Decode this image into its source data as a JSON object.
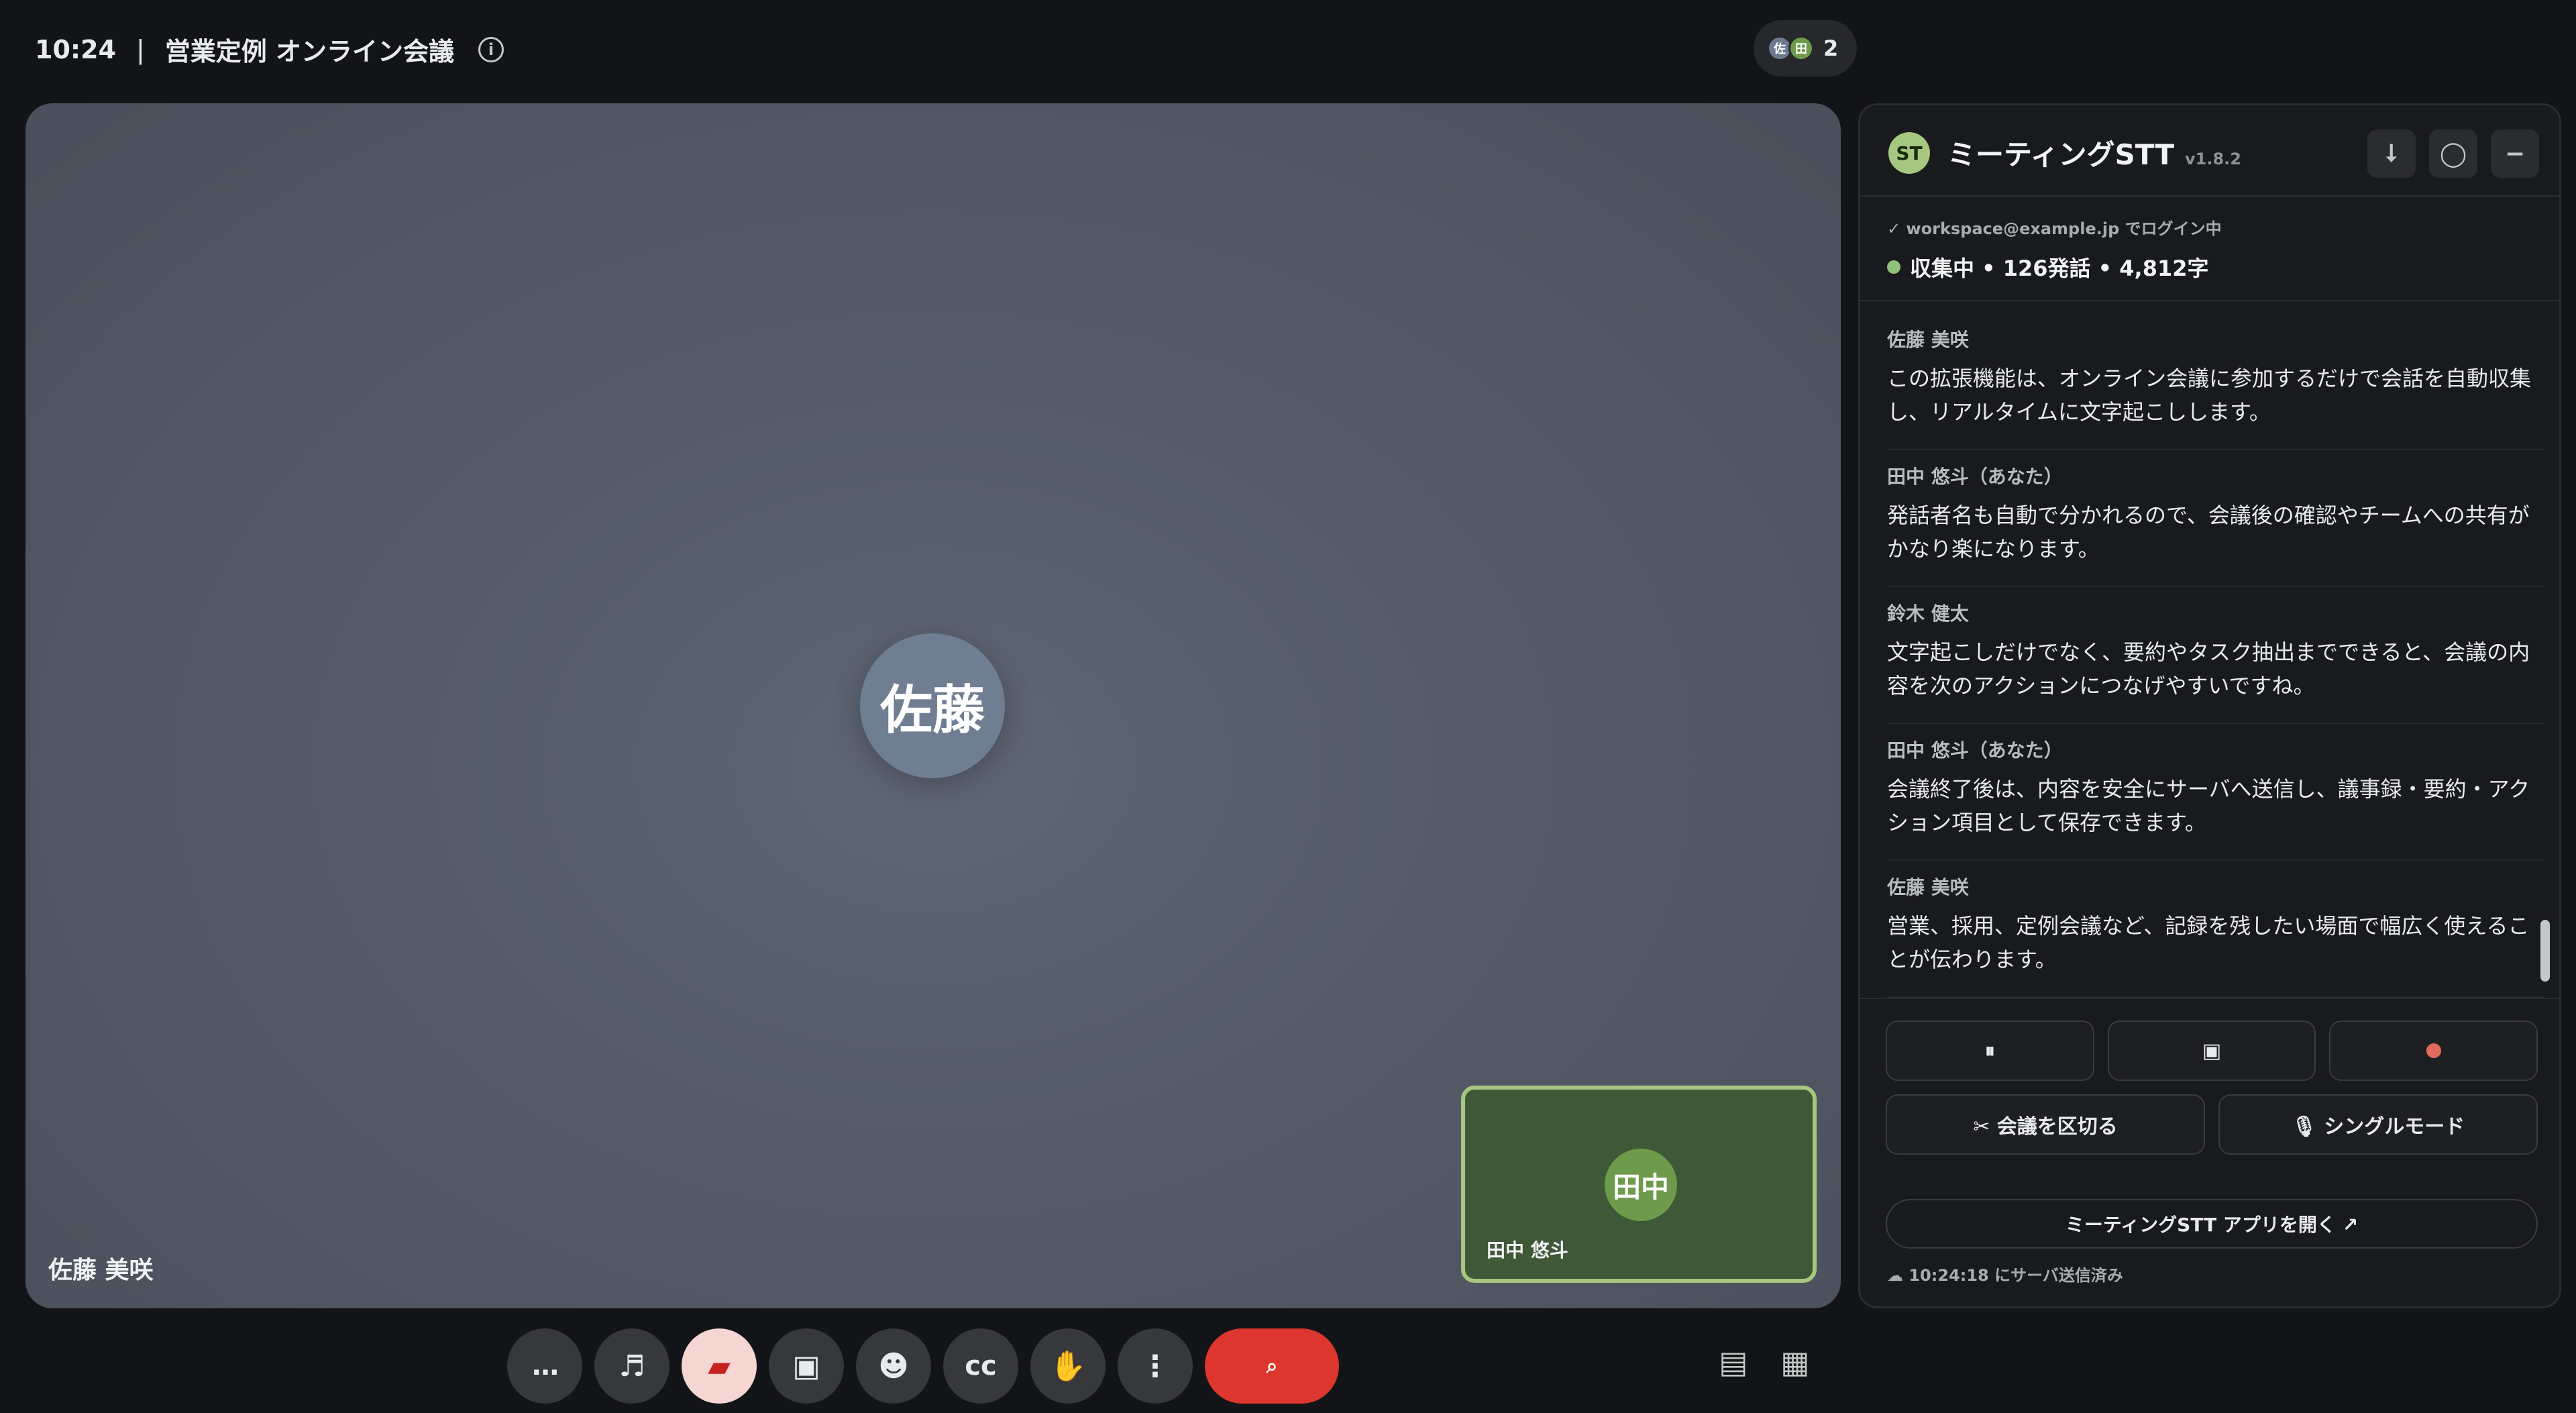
{
  "topbar": {
    "time": "10:24",
    "separator": "|",
    "meeting_title": "営業定例 オンライン会議",
    "info_icon": "ⓘ",
    "participants": [
      {
        "initial": "佐"
      },
      {
        "initial": "田"
      }
    ],
    "participant_count": "2"
  },
  "stage": {
    "main_avatar": "佐藤",
    "main_name": "佐藤 美咲",
    "self_avatar": "田中",
    "self_name": "田中 悠斗"
  },
  "controls": [
    {
      "name": "more-options-button",
      "glyph": "…"
    },
    {
      "name": "music-button",
      "glyph": "♬"
    },
    {
      "name": "eraser-button",
      "glyph": "▰"
    },
    {
      "name": "present-button",
      "glyph": "▣"
    },
    {
      "name": "emoji-button",
      "glyph": "☻"
    },
    {
      "name": "captions-button",
      "glyph": "cc"
    },
    {
      "name": "raise-hand-button",
      "glyph": "✋"
    },
    {
      "name": "menu-button",
      "glyph": "⋮"
    },
    {
      "name": "leave-call-button",
      "glyph": "⌕"
    }
  ],
  "layout_icons": [
    {
      "name": "list-layout-icon",
      "glyph": "▤"
    },
    {
      "name": "grid-layout-icon",
      "glyph": "▦"
    }
  ],
  "panel": {
    "logo": "ST",
    "title": "ミーティングSTT",
    "version": "v1.8.2",
    "header_buttons": [
      {
        "name": "pin-button",
        "glyph": "⭣"
      },
      {
        "name": "circle-button",
        "glyph": "◯"
      },
      {
        "name": "minimize-button",
        "glyph": "−"
      }
    ],
    "login_status": "✓ workspace@example.jp でログイン中",
    "collect_status": "収集中 • 126発話 • 4,812字",
    "transcript": [
      {
        "speaker": "佐藤 美咲",
        "text": "この拡張機能は、オンライン会議に参加するだけで会話を自動収集し、リアルタイムに文字起こしします。"
      },
      {
        "speaker": "田中 悠斗（あなた）",
        "text": "発話者名も自動で分かれるので、会議後の確認やチームへの共有がかなり楽になります。"
      },
      {
        "speaker": "鈴木 健太",
        "text": "文字起こしだけでなく、要約やタスク抽出までできると、会議の内容を次のアクションにつなげやすいですね。"
      },
      {
        "speaker": "田中 悠斗（あなた）",
        "text": "会議終了後は、内容を安全にサーバへ送信し、議事録・要約・アクション項目として保存できます。"
      },
      {
        "speaker": "佐藤 美咲",
        "text": "営業、採用、定例会議など、記録を残したい場面で幅広く使えることが伝わります。"
      }
    ],
    "pause_label": "⏸",
    "stop_label": "▣",
    "split_label": "✂ 会議を区切る",
    "single_mode_label": "🎙 シングルモード",
    "open_app_label": "ミーティングSTT アプリを開く ↗",
    "sent_status": "☁ 10:24:18 にサーバ送信済み"
  }
}
